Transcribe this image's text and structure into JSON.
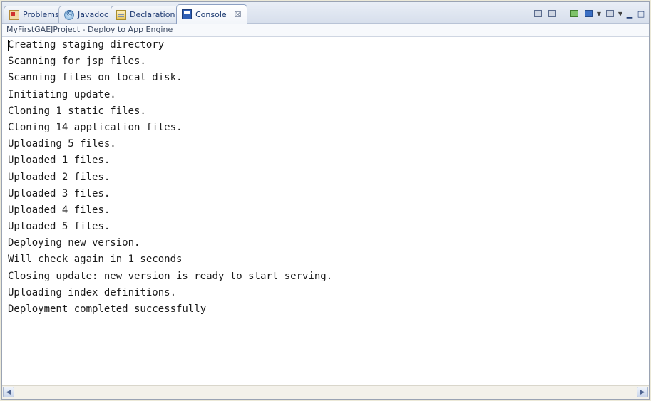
{
  "tabs": [
    {
      "label": "Problems",
      "icon": "problems-icon"
    },
    {
      "label": "Javadoc",
      "icon": "javadoc-icon"
    },
    {
      "label": "Declaration",
      "icon": "declaration-icon"
    },
    {
      "label": "Console",
      "icon": "console-icon",
      "active": true,
      "close": "☒"
    }
  ],
  "description": "MyFirstGAEJProject - Deploy to App Engine",
  "console_lines": [
    "Creating staging directory",
    "Scanning for jsp files.",
    "Scanning files on local disk.",
    "Initiating update.",
    "Cloning 1 static files.",
    "Cloning 14 application files.",
    "Uploading 5 files.",
    "Uploaded 1 files.",
    "Uploaded 2 files.",
    "Uploaded 3 files.",
    "Uploaded 4 files.",
    "Uploaded 5 files.",
    "Deploying new version.",
    "Will check again in 1 seconds",
    "Closing update: new version is ready to start serving.",
    "Uploading index definitions.",
    "Deployment completed successfully"
  ],
  "colors": {
    "tab_text": "#1f3b73",
    "console_text": "#1a1a1a",
    "accent": "#2f5fb5"
  }
}
